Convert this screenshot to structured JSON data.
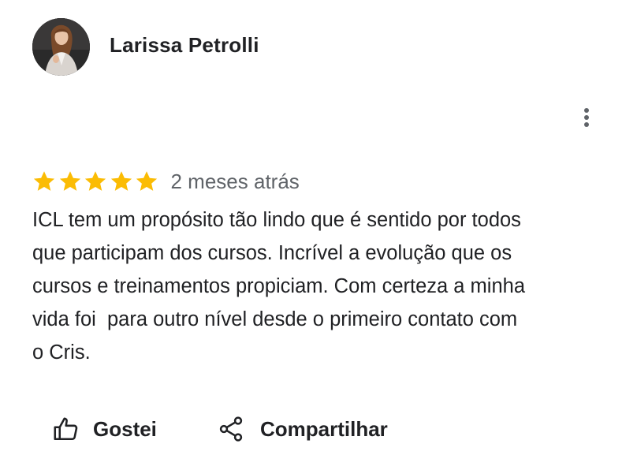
{
  "review": {
    "author": {
      "name": "Larissa Petrolli",
      "avatar_icon": "profile-photo"
    },
    "menu_icon": "more-vertical-icon",
    "rating": {
      "stars": 5,
      "max": 5,
      "star_color": "#fbbc04"
    },
    "date": "2 meses atrás",
    "text": "ICL tem um propósito tão lindo que é sentido por todos\nque participam dos cursos. Incrível a evolução que os\ncursos e treinamentos propiciam. Com certeza a minha\nvida foi  para outro nível desde o primeiro contato com\no Cris.",
    "actions": {
      "like_label": "Gostei",
      "like_icon": "thumbs-up-icon",
      "share_label": "Compartilhar",
      "share_icon": "share-icon"
    }
  }
}
